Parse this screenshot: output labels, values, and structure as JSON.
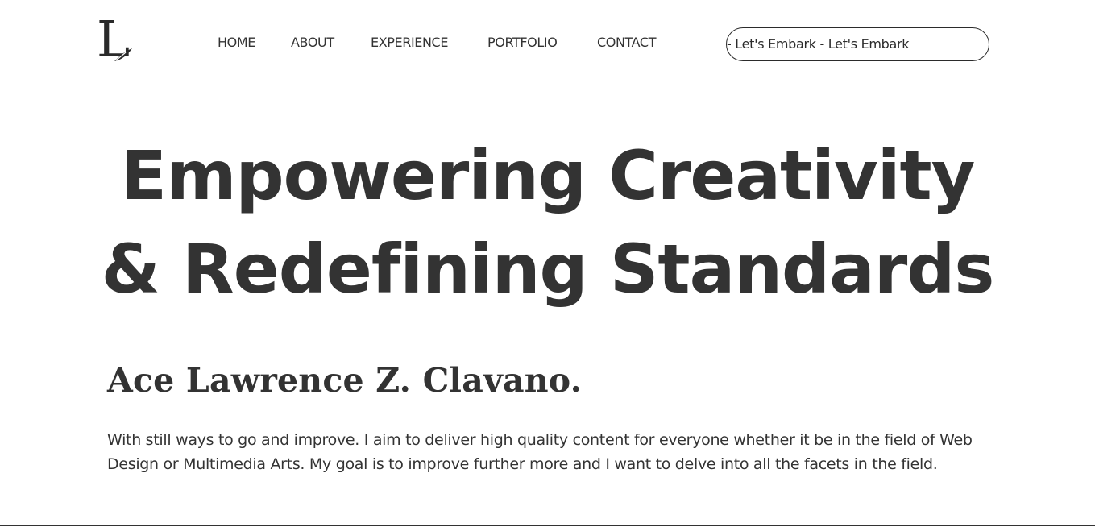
{
  "header": {
    "logo_letter": "L",
    "nav": [
      {
        "label": "HOME"
      },
      {
        "label": "ABOUT"
      },
      {
        "label": "EXPERIENCE"
      },
      {
        "label": "PORTFOLIO"
      },
      {
        "label": "CONTACT"
      }
    ],
    "cta_marquee": "rk - Let's Embark - Let's Embark"
  },
  "hero": {
    "title_line1": "Empowering Creativity",
    "title_line2": "& Redefining Standards",
    "name": "Ace Lawrence Z. Clavano.",
    "bio": "With still ways to go and improve. I aim to deliver high quality content for everyone whether it be in the field of Web Design or Multimedia Arts. My goal is to improve further more and I want to delve into all the facets in the field."
  },
  "icons": {
    "logo": "quill-pen-icon"
  },
  "colors": {
    "text": "#333333",
    "background": "#ffffff",
    "border": "#2b2b2b"
  }
}
